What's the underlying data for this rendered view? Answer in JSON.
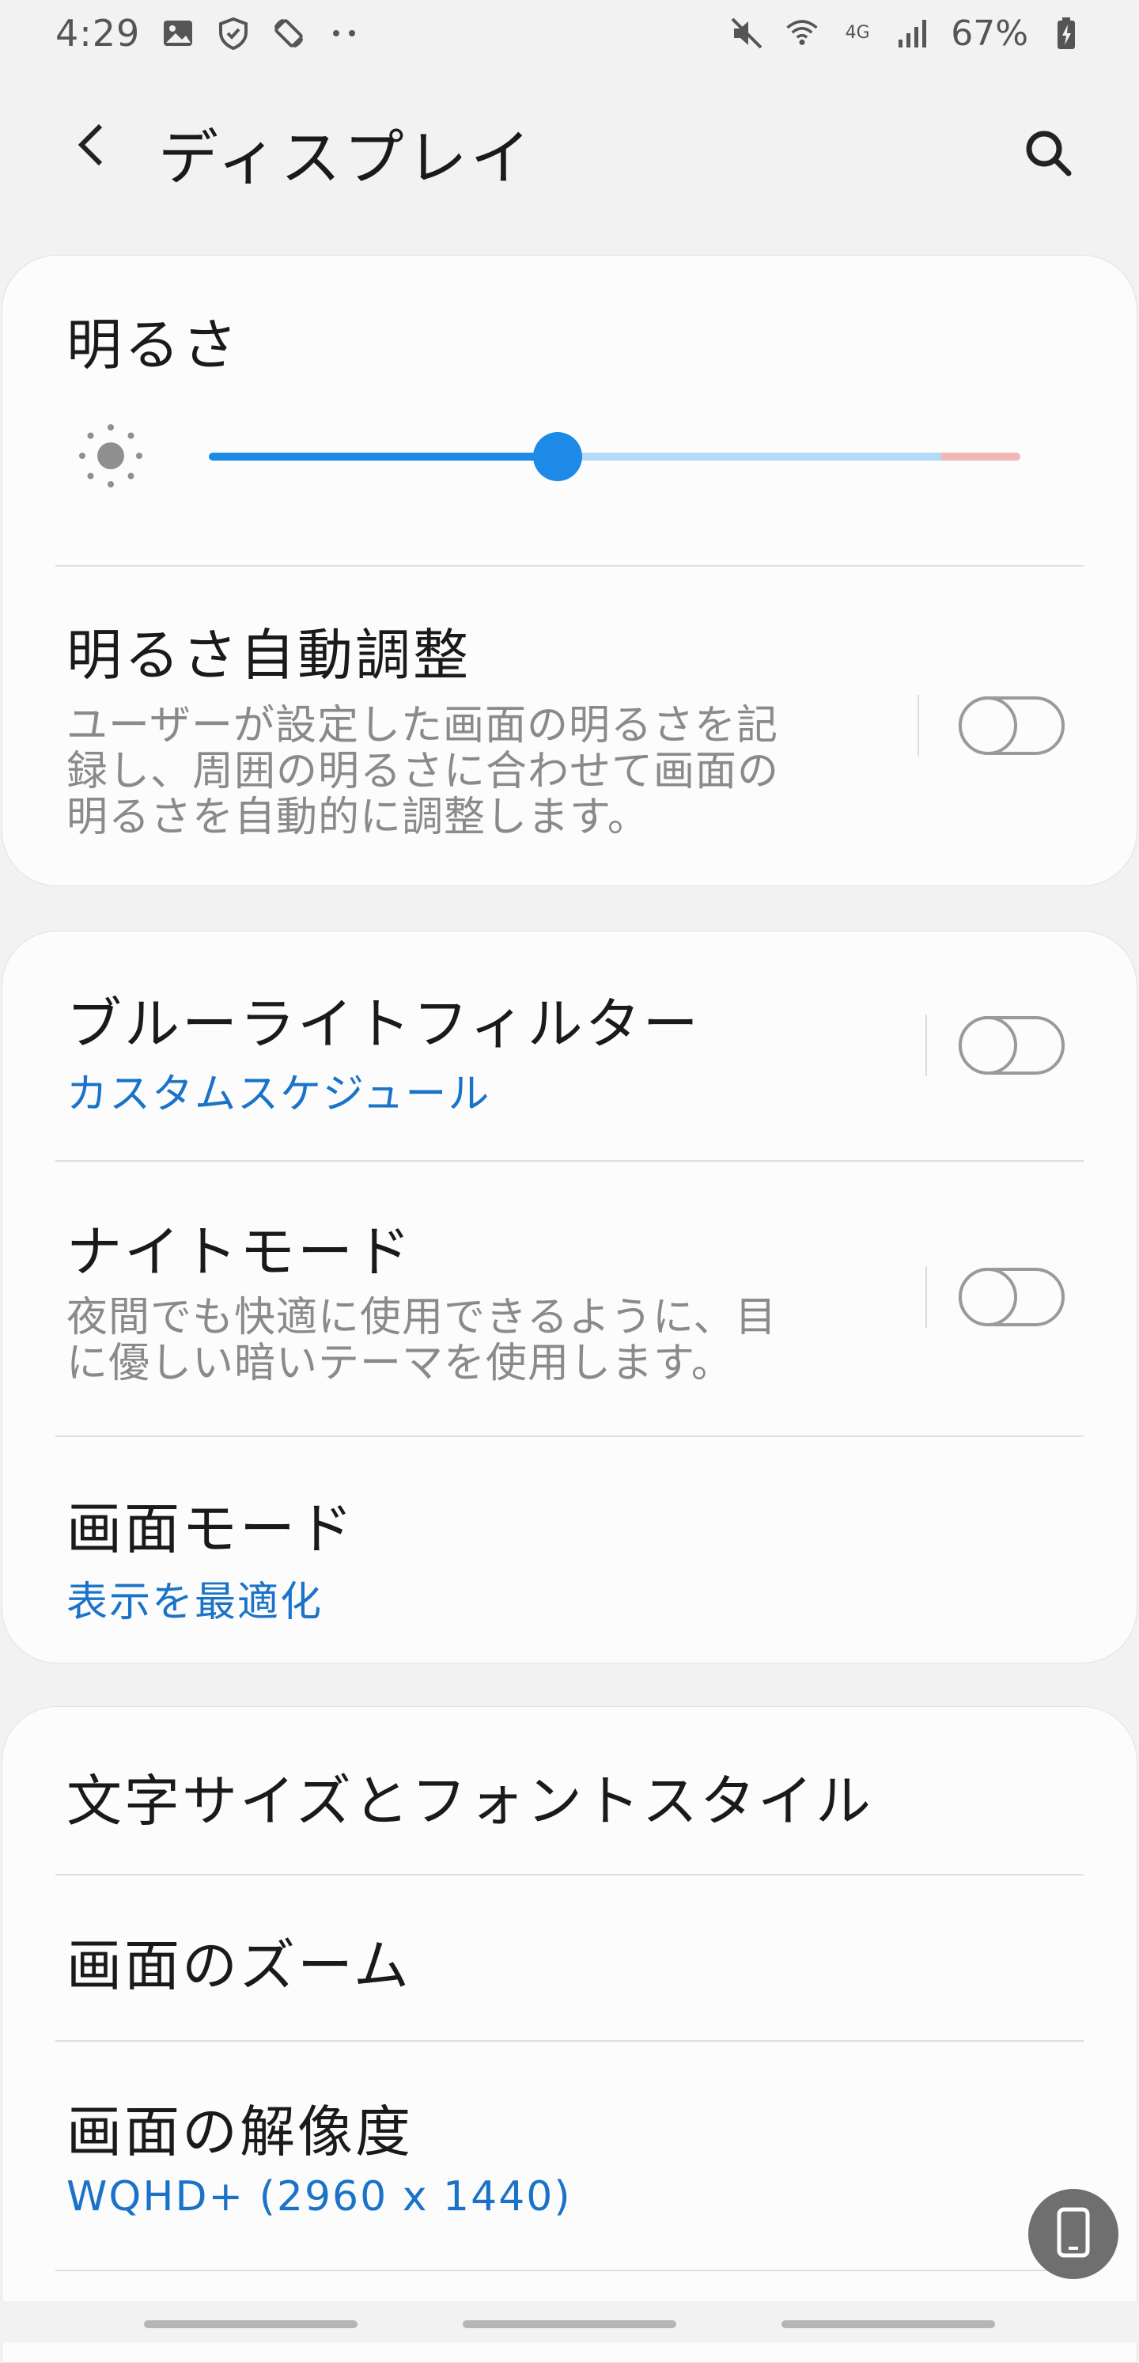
{
  "status_bar": {
    "time": "4:29",
    "network_type": "4G",
    "battery_percent": "67%",
    "icons": [
      "gallery-icon",
      "shield-icon",
      "rotate-icon",
      "more-dots-icon",
      "mute-icon",
      "wifi-icon",
      "signal-icon",
      "battery-charging-icon"
    ]
  },
  "app_bar": {
    "title": "ディスプレイ",
    "back_icon": "back-arrow-icon",
    "search_icon": "search-icon"
  },
  "brightness": {
    "title": "明るさ",
    "level": 0.43,
    "icon": "sun-icon",
    "colors": {
      "fill": "#1e8ae8",
      "track": "#b3dbf7",
      "end": "#f2b8b8"
    }
  },
  "auto_brightness": {
    "title": "明るさ自動調整",
    "desc_lines": [
      "ユーザーが設定した画面の明るさを記",
      "録し、周囲の明るさに合わせて画面の",
      "明るさを自動的に調整します。"
    ],
    "enabled": false
  },
  "blue_light": {
    "title": "ブルーライトフィルター",
    "subtitle": "カスタムスケジュール",
    "enabled": false
  },
  "night_mode": {
    "title": "ナイトモード",
    "desc_lines": [
      "夜間でも快適に使用できるように、目",
      "に優しい暗いテーマを使用します。"
    ],
    "enabled": false
  },
  "screen_mode": {
    "title": "画面モード",
    "subtitle": "表示を最適化"
  },
  "font": {
    "title": "文字サイズとフォントスタイル"
  },
  "zoom": {
    "title": "画面のズーム"
  },
  "resolution": {
    "title": "画面の解像度",
    "subtitle": "WQHD+ (2960 x 1440)"
  },
  "fab_icon": "phone-screen-icon",
  "accent_color": "#1a73c8"
}
